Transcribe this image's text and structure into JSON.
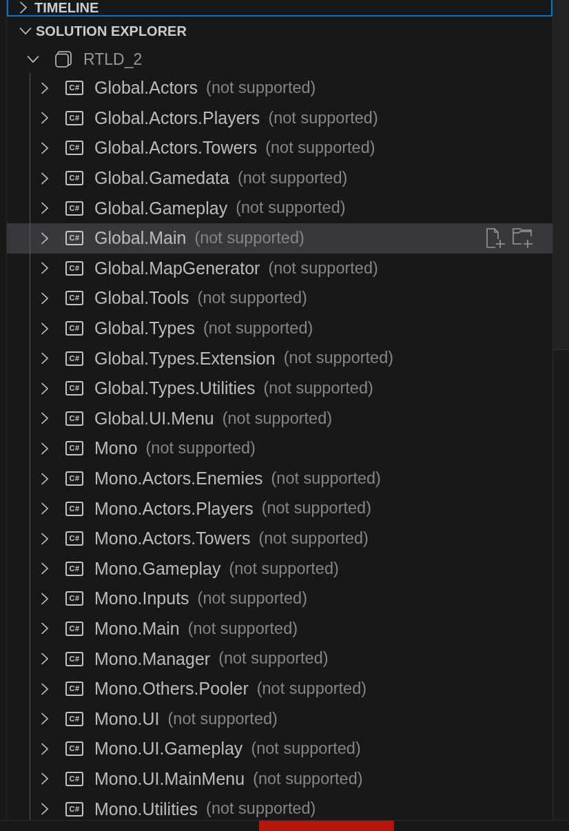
{
  "timeline": {
    "title": "TIMELINE",
    "expanded": false,
    "focused": true
  },
  "solution_explorer": {
    "title": "SOLUTION EXPLORER",
    "expanded": true,
    "tree": [
      {
        "label": "RTLD_2",
        "expanded": true,
        "children": [
          {
            "badge": "C#",
            "label": "Global.Actors",
            "description": "(not supported)",
            "expanded": false,
            "hovered": false
          },
          {
            "badge": "C#",
            "label": "Global.Actors.Players",
            "description": "(not supported)",
            "expanded": false,
            "hovered": false
          },
          {
            "badge": "C#",
            "label": "Global.Actors.Towers",
            "description": "(not supported)",
            "expanded": false,
            "hovered": false
          },
          {
            "badge": "C#",
            "label": "Global.Gamedata",
            "description": "(not supported)",
            "expanded": false,
            "hovered": false
          },
          {
            "badge": "C#",
            "label": "Global.Gameplay",
            "description": "(not supported)",
            "expanded": false,
            "hovered": false
          },
          {
            "badge": "C#",
            "label": "Global.Main",
            "description": "(not supported)",
            "expanded": false,
            "hovered": true
          },
          {
            "badge": "C#",
            "label": "Global.MapGenerator",
            "description": "(not supported)",
            "expanded": false,
            "hovered": false
          },
          {
            "badge": "C#",
            "label": "Global.Tools",
            "description": "(not supported)",
            "expanded": false,
            "hovered": false
          },
          {
            "badge": "C#",
            "label": "Global.Types",
            "description": "(not supported)",
            "expanded": false,
            "hovered": false
          },
          {
            "badge": "C#",
            "label": "Global.Types.Extension",
            "description": "(not supported)",
            "expanded": false,
            "hovered": false
          },
          {
            "badge": "C#",
            "label": "Global.Types.Utilities",
            "description": "(not supported)",
            "expanded": false,
            "hovered": false
          },
          {
            "badge": "C#",
            "label": "Global.UI.Menu",
            "description": "(not supported)",
            "expanded": false,
            "hovered": false
          },
          {
            "badge": "C#",
            "label": "Mono",
            "description": "(not supported)",
            "expanded": false,
            "hovered": false
          },
          {
            "badge": "C#",
            "label": "Mono.Actors.Enemies",
            "description": "(not supported)",
            "expanded": false,
            "hovered": false
          },
          {
            "badge": "C#",
            "label": "Mono.Actors.Players",
            "description": "(not supported)",
            "expanded": false,
            "hovered": false
          },
          {
            "badge": "C#",
            "label": "Mono.Actors.Towers",
            "description": "(not supported)",
            "expanded": false,
            "hovered": false
          },
          {
            "badge": "C#",
            "label": "Mono.Gameplay",
            "description": "(not supported)",
            "expanded": false,
            "hovered": false
          },
          {
            "badge": "C#",
            "label": "Mono.Inputs",
            "description": "(not supported)",
            "expanded": false,
            "hovered": false
          },
          {
            "badge": "C#",
            "label": "Mono.Main",
            "description": "(not supported)",
            "expanded": false,
            "hovered": false
          },
          {
            "badge": "C#",
            "label": "Mono.Manager",
            "description": "(not supported)",
            "expanded": false,
            "hovered": false
          },
          {
            "badge": "C#",
            "label": "Mono.Others.Pooler",
            "description": "(not supported)",
            "expanded": false,
            "hovered": false
          },
          {
            "badge": "C#",
            "label": "Mono.UI",
            "description": "(not supported)",
            "expanded": false,
            "hovered": false
          },
          {
            "badge": "C#",
            "label": "Mono.UI.Gameplay",
            "description": "(not supported)",
            "expanded": false,
            "hovered": false
          },
          {
            "badge": "C#",
            "label": "Mono.UI.MainMenu",
            "description": "(not supported)",
            "expanded": false,
            "hovered": false
          },
          {
            "badge": "C#",
            "label": "Mono.Utilities",
            "description": "(not supported)",
            "expanded": false,
            "hovered": false
          }
        ]
      }
    ]
  }
}
